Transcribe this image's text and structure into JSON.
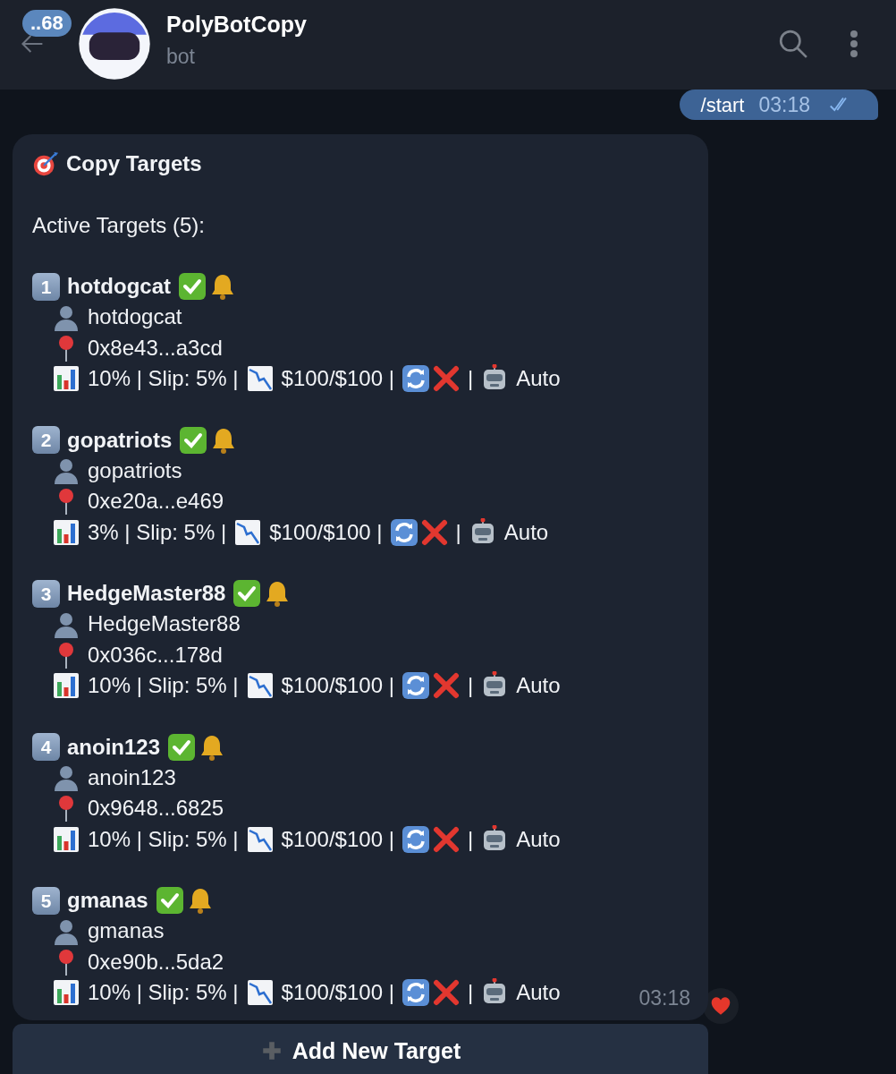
{
  "header": {
    "back_badge": "..68",
    "title": "PolyBotCopy",
    "subtitle": "bot"
  },
  "outgoing_message": {
    "text": "/start",
    "time": "03:18",
    "read": true
  },
  "incoming_message": {
    "title": "Copy Targets",
    "subtitle": "Active Targets (5):",
    "targets": [
      {
        "number": "1",
        "name": "hotdogcat",
        "active": true,
        "notifications": true,
        "username": "hotdogcat",
        "address": "0x8e43...a3cd",
        "stats": "10% | Slip: 5% |",
        "limit": "$100/$100 |",
        "auto_copy": false,
        "separator": "|",
        "mode": "Auto"
      },
      {
        "number": "2",
        "name": "gopatriots",
        "active": true,
        "notifications": true,
        "username": "gopatriots",
        "address": "0xe20a...e469",
        "stats": "3% | Slip: 5% |",
        "limit": "$100/$100 |",
        "auto_copy": false,
        "separator": "|",
        "mode": "Auto"
      },
      {
        "number": "3",
        "name": "HedgeMaster88",
        "active": true,
        "notifications": true,
        "username": "HedgeMaster88",
        "address": "0x036c...178d",
        "stats": "10% | Slip: 5% |",
        "limit": "$100/$100 |",
        "auto_copy": false,
        "separator": "|",
        "mode": "Auto"
      },
      {
        "number": "4",
        "name": "anoin123",
        "active": true,
        "notifications": true,
        "username": "anoin123",
        "address": "0x9648...6825",
        "stats": "10% | Slip: 5% |",
        "limit": "$100/$100 |",
        "auto_copy": false,
        "separator": "|",
        "mode": "Auto"
      },
      {
        "number": "5",
        "name": "gmanas",
        "active": true,
        "notifications": true,
        "username": "gmanas",
        "address": "0xe90b...5da2",
        "stats": "10% | Slip: 5% |",
        "limit": "$100/$100 |",
        "auto_copy": false,
        "separator": "|",
        "mode": "Auto"
      }
    ],
    "time": "03:18",
    "reaction": {
      "kind": "heart"
    }
  },
  "buttons": [
    {
      "label": "Add New Target"
    }
  ]
}
